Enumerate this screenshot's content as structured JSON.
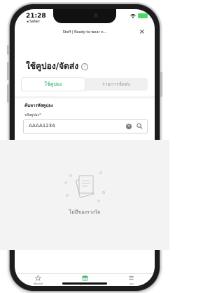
{
  "status_bar": {
    "time": "21:28",
    "back_app": "◂ Safari"
  },
  "browser": {
    "page_title": "Staff | Ready-to-wear ค...",
    "close_label": "×"
  },
  "page": {
    "heading": "ใช้คูปอง/จัดส่ง",
    "help_icon": "?"
  },
  "tabs": [
    {
      "label": "ใช้คูปอง"
    },
    {
      "label": "รายการจัดส่ง"
    }
  ],
  "search": {
    "section_label": "ค้นหารหัสคูปอง",
    "field_label": "รหัสคูปอง*",
    "value": "AAAA1234",
    "clear_label": "×"
  },
  "empty_state": {
    "text": "ไม่มีของรางวัล"
  },
  "tabbar": {
    "items": [
      {
        "label": "เช็คเพยล์",
        "icon": "star-icon"
      },
      {
        "label": "ใช้คูปอง/จัดส่ง",
        "icon": "gift-icon"
      },
      {
        "label": "เมนู",
        "icon": "menu-icon"
      }
    ]
  },
  "colors": {
    "accent": "#19a55a",
    "overlay": "#f3f3f3"
  }
}
